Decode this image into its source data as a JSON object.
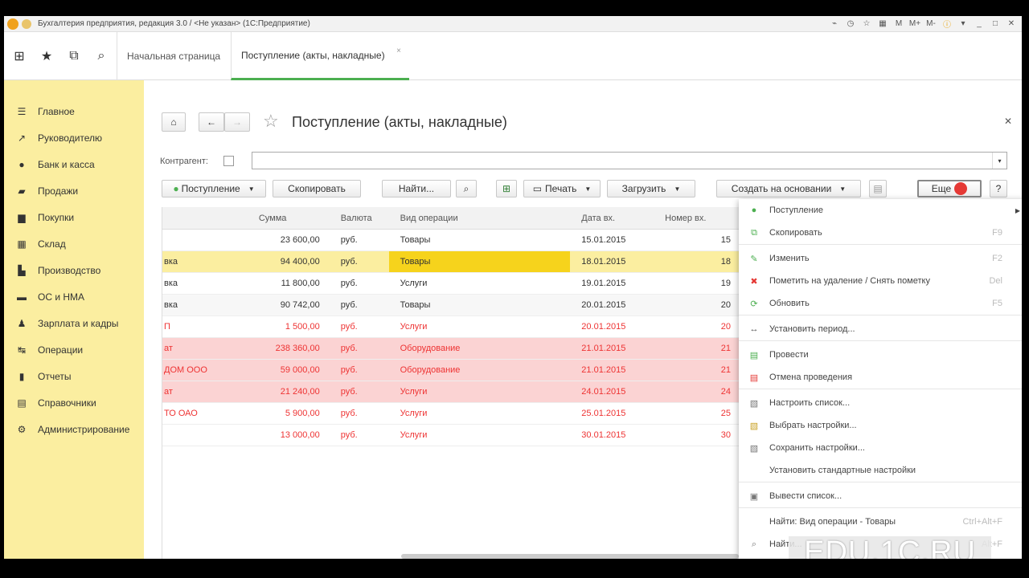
{
  "window": {
    "title": "Бухгалтерия предприятия, редакция 3.0 / <Не указан> (1С:Предприятие)",
    "controls": [
      "M",
      "M+",
      "M-"
    ]
  },
  "tabs": [
    {
      "label": "Начальная страница"
    },
    {
      "label": "Поступление (акты, накладные)"
    }
  ],
  "sidebar": {
    "items": [
      {
        "label": "Главное",
        "icon": "list-icon"
      },
      {
        "label": "Руководителю",
        "icon": "trend-icon"
      },
      {
        "label": "Банк и касса",
        "icon": "bank-icon"
      },
      {
        "label": "Продажи",
        "icon": "bag-icon"
      },
      {
        "label": "Покупки",
        "icon": "cart-icon"
      },
      {
        "label": "Склад",
        "icon": "warehouse-icon"
      },
      {
        "label": "Производство",
        "icon": "factory-icon"
      },
      {
        "label": "ОС и НМА",
        "icon": "truck-icon"
      },
      {
        "label": "Зарплата и кадры",
        "icon": "people-icon"
      },
      {
        "label": "Операции",
        "icon": "operations-icon"
      },
      {
        "label": "Отчеты",
        "icon": "chart-icon"
      },
      {
        "label": "Справочники",
        "icon": "book-icon"
      },
      {
        "label": "Администрирование",
        "icon": "gear-icon"
      }
    ]
  },
  "form": {
    "title": "Поступление (акты, накладные)",
    "kontragent_label": "Контрагент:",
    "toolbar": {
      "postuplenie": "Поступление",
      "kopirovat": "Скопировать",
      "naiti": "Найти...",
      "pechat": "Печать",
      "zagruzit": "Загрузить",
      "sozdat": "Создать на основании",
      "eshe": "Еще",
      "help": "?"
    }
  },
  "table": {
    "columns": [
      "Сумма",
      "Валюта",
      "Вид операции",
      "Дата вх.",
      "Номер вх."
    ],
    "rows": [
      {
        "c0": "",
        "sum": "23 600,00",
        "cur": "руб.",
        "op": "Товары",
        "date": "15.01.2015",
        "num": "15",
        "style": "row"
      },
      {
        "c0": "вка",
        "sum": "94 400,00",
        "cur": "руб.",
        "op": "Товары",
        "date": "18.01.2015",
        "num": "18",
        "style": "row sel"
      },
      {
        "c0": "вка",
        "sum": "11 800,00",
        "cur": "руб.",
        "op": "Услуги",
        "date": "19.01.2015",
        "num": "19",
        "style": "row"
      },
      {
        "c0": "вка",
        "sum": "90 742,00",
        "cur": "руб.",
        "op": "Товары",
        "date": "20.01.2015",
        "num": "20",
        "style": "row alt"
      },
      {
        "c0": "П",
        "sum": "1 500,00",
        "cur": "руб.",
        "op": "Услуги",
        "date": "20.01.2015",
        "num": "20",
        "style": "row red"
      },
      {
        "c0": "ат",
        "sum": "238 360,00",
        "cur": "руб.",
        "op": "Оборудование",
        "date": "21.01.2015",
        "num": "21",
        "style": "row del"
      },
      {
        "c0": "ДОМ ООО",
        "sum": "59 000,00",
        "cur": "руб.",
        "op": "Оборудование",
        "date": "21.01.2015",
        "num": "21",
        "style": "row del"
      },
      {
        "c0": "ат",
        "sum": "21 240,00",
        "cur": "руб.",
        "op": "Услуги",
        "date": "24.01.2015",
        "num": "24",
        "style": "row del"
      },
      {
        "c0": "ТО ОАО",
        "sum": "5 900,00",
        "cur": "руб.",
        "op": "Услуги",
        "date": "25.01.2015",
        "num": "25",
        "style": "row red"
      },
      {
        "c0": "",
        "sum": "13 000,00",
        "cur": "руб.",
        "op": "Услуги",
        "date": "30.01.2015",
        "num": "30",
        "style": "row red"
      }
    ]
  },
  "menu": {
    "items": [
      {
        "label": "Поступление",
        "shortcut": "",
        "icon": "add-green-icon",
        "arrow": true
      },
      {
        "label": "Скопировать",
        "shortcut": "F9",
        "icon": "copy-icon"
      },
      {
        "sep": true
      },
      {
        "label": "Изменить",
        "shortcut": "F2",
        "icon": "pencil-icon"
      },
      {
        "label": "Пометить на удаление / Снять пометку",
        "shortcut": "Del",
        "icon": "delete-mark-icon"
      },
      {
        "label": "Обновить",
        "shortcut": "F5",
        "icon": "refresh-icon"
      },
      {
        "sep": true
      },
      {
        "label": "Установить период...",
        "shortcut": "",
        "icon": "period-icon"
      },
      {
        "sep": true
      },
      {
        "label": "Провести",
        "shortcut": "",
        "icon": "post-icon"
      },
      {
        "label": "Отмена проведения",
        "shortcut": "",
        "icon": "unpost-icon"
      },
      {
        "sep": true
      },
      {
        "label": "Настроить список...",
        "shortcut": "",
        "icon": "settings-list-icon"
      },
      {
        "label": "Выбрать настройки...",
        "shortcut": "",
        "icon": "select-settings-icon"
      },
      {
        "label": "Сохранить настройки...",
        "shortcut": "",
        "icon": "save-settings-icon"
      },
      {
        "label": "Установить стандартные настройки",
        "shortcut": "",
        "icon": ""
      },
      {
        "sep": true
      },
      {
        "label": "Вывести список...",
        "shortcut": "",
        "icon": "export-list-icon"
      },
      {
        "sep": true
      },
      {
        "label": "Найти: Вид операции - Товары",
        "shortcut": "Ctrl+Alt+F",
        "icon": ""
      },
      {
        "label": "Найти...",
        "shortcut": "Alt+F",
        "icon": "search-icon"
      },
      {
        "label": "",
        "shortcut": "",
        "icon": "export-icon"
      }
    ]
  },
  "watermark": "EDU.1C.RU",
  "colors": {
    "sidebar": "#fbeea0",
    "selected_cell": "#f6d31c",
    "deleted_row": "#fbd3d3",
    "accent": "#4caf50"
  }
}
